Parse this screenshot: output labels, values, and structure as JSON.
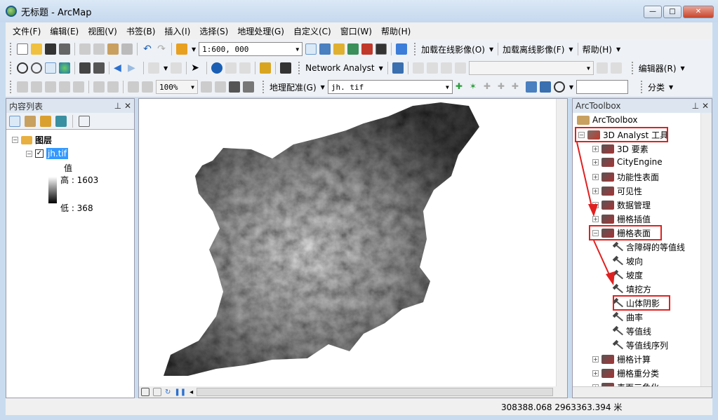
{
  "window": {
    "title": "无标题 - ArcMap",
    "min": "—",
    "max": "□",
    "close": "✕"
  },
  "menu": [
    "文件(F)",
    "编辑(E)",
    "视图(V)",
    "书签(B)",
    "插入(I)",
    "选择(S)",
    "地理处理(G)",
    "自定义(C)",
    "窗口(W)",
    "帮助(H)"
  ],
  "toolbar1": {
    "scale": "1:600, 000",
    "online": "加载在线影像(O)",
    "offline": "加载离线影像(F)",
    "help": "帮助(H)"
  },
  "toolbar2": {
    "network": "Network Analyst",
    "editor": "编辑器(R)"
  },
  "toolbar3": {
    "zoom": "100%",
    "georef": "地理配准(G)",
    "layer": "jh. tif",
    "classify": "分类"
  },
  "toc": {
    "title": "内容列表",
    "layers_label": "图层",
    "layer_name": "jh.tif",
    "value_label": "值",
    "high": "高 : 1603",
    "low": "低 : 368"
  },
  "toolbox": {
    "title": "ArcToolbox",
    "root": "ArcToolbox",
    "analyst": "3D Analyst 工具",
    "items": [
      {
        "label": "3D 要素",
        "type": "set",
        "level": 1
      },
      {
        "label": "CityEngine",
        "type": "set",
        "level": 1
      },
      {
        "label": "功能性表面",
        "type": "set",
        "level": 1
      },
      {
        "label": "可见性",
        "type": "set",
        "level": 1
      },
      {
        "label": "数据管理",
        "type": "set",
        "level": 1
      },
      {
        "label": "栅格插值",
        "type": "set",
        "level": 1
      },
      {
        "label": "栅格表面",
        "type": "set",
        "level": 1,
        "open": true
      },
      {
        "label": "含障碍的等值线",
        "type": "tool",
        "level": 2
      },
      {
        "label": "坡向",
        "type": "tool",
        "level": 2
      },
      {
        "label": "坡度",
        "type": "tool",
        "level": 2
      },
      {
        "label": "填挖方",
        "type": "tool",
        "level": 2
      },
      {
        "label": "山体阴影",
        "type": "tool",
        "level": 2
      },
      {
        "label": "曲率",
        "type": "tool",
        "level": 2
      },
      {
        "label": "等值线",
        "type": "tool",
        "level": 2
      },
      {
        "label": "等值线序列",
        "type": "tool",
        "level": 2
      },
      {
        "label": "栅格计算",
        "type": "set",
        "level": 1
      },
      {
        "label": "栅格重分类",
        "type": "set",
        "level": 1
      },
      {
        "label": "表面三角化",
        "type": "set",
        "level": 1
      }
    ]
  },
  "status": {
    "coords": "308388.068  2963363.394 米"
  },
  "colors": {
    "highlight": "#e02020",
    "selection": "#3399ff"
  }
}
